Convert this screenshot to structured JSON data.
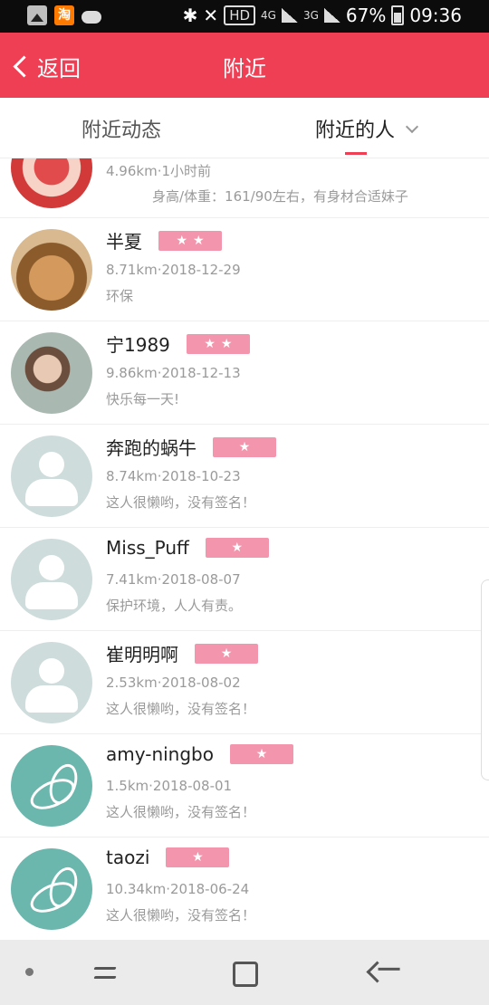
{
  "status_bar": {
    "icons": [
      "gallery-icon",
      "taobao-icon",
      "weather-cloud-icon",
      "bluetooth-icon",
      "mute-icon"
    ],
    "hd": "HD",
    "network": "4G",
    "network2": "3G",
    "battery": "67%",
    "time": "09:36",
    "taobao_glyph": "淘"
  },
  "header": {
    "back_label": "返回",
    "title": "附近"
  },
  "tabs": [
    {
      "label": "附近动态",
      "active": false
    },
    {
      "label": "附近的人",
      "active": true
    }
  ],
  "list": [
    {
      "name": "",
      "stars": 0,
      "meta": "4.96km·1小时前",
      "signature": "身高/体重：161/90左右，有身材合适妹子",
      "avatar": "photo"
    },
    {
      "name": "半夏",
      "stars": 2,
      "meta": "8.71km·2018-12-29",
      "signature": "环保",
      "avatar": "cat-photo"
    },
    {
      "name": "宁1989",
      "stars": 2,
      "meta": "9.86km·2018-12-13",
      "signature": "快乐每一天!",
      "avatar": "girl-photo"
    },
    {
      "name": "奔跑的蜗牛",
      "stars": 1,
      "meta": "8.74km·2018-10-23",
      "signature": "这人很懒哟，没有签名！",
      "avatar": "default-user"
    },
    {
      "name": "Miss_Puff",
      "stars": 1,
      "meta": "7.41km·2018-08-07",
      "signature": "保护环境，人人有责。",
      "avatar": "default-user"
    },
    {
      "name": "崔明明啊",
      "stars": 1,
      "meta": "2.53km·2018-08-02",
      "signature": "这人很懒哟，没有签名！",
      "avatar": "default-user"
    },
    {
      "name": "amy-ningbo",
      "stars": 1,
      "meta": "1.5km·2018-08-01",
      "signature": "这人很懒哟，没有签名！",
      "avatar": "leaf"
    },
    {
      "name": "taozi",
      "stars": 1,
      "meta": "10.34km·2018-06-24",
      "signature": "这人很懒哟，没有签名！",
      "avatar": "leaf"
    }
  ],
  "colors": {
    "accent": "#ee3f55",
    "badge": "#f396ad",
    "meta_text": "#9a9a9a"
  },
  "navbar": {
    "buttons": [
      "nav-dot",
      "recent-apps-icon",
      "home-icon",
      "back-icon"
    ]
  }
}
